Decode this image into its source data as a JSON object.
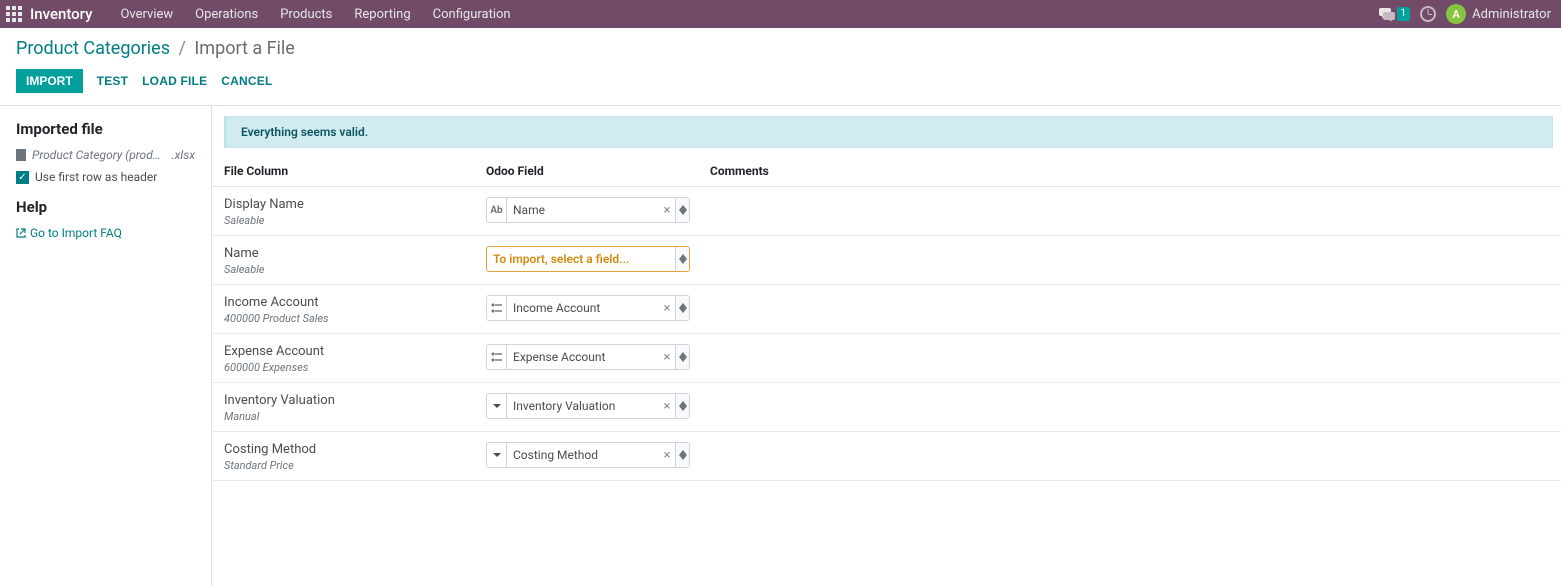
{
  "topbar": {
    "app_name": "Inventory",
    "nav": [
      "Overview",
      "Operations",
      "Products",
      "Reporting",
      "Configuration"
    ],
    "badge_count": "1",
    "avatar_letter": "A",
    "username": "Administrator"
  },
  "breadcrumb": {
    "parent": "Product Categories",
    "current": "Import a File"
  },
  "actions": {
    "import": "IMPORT",
    "test": "TEST",
    "load": "LOAD FILE",
    "cancel": "CANCEL"
  },
  "sidebar": {
    "imported_heading": "Imported file",
    "file_name": "Product Category (product.c…",
    "file_ext": ".xlsx",
    "first_row_label": "Use first row as header",
    "help_heading": "Help",
    "faq_label": "Go to Import FAQ"
  },
  "main": {
    "alert": "Everything seems valid.",
    "headers": {
      "file_col": "File Column",
      "odoo_field": "Odoo Field",
      "comments": "Comments"
    },
    "rows": [
      {
        "column": "Display Name",
        "sample": "Saleable",
        "field_type": "text",
        "field_value": "Name",
        "has_clear": true
      },
      {
        "column": "Name",
        "sample": "Saleable",
        "field_type": "none",
        "field_value": "To import, select a field...",
        "has_clear": false
      },
      {
        "column": "Income Account",
        "sample": "400000 Product Sales",
        "field_type": "m2o",
        "field_value": "Income Account",
        "has_clear": true
      },
      {
        "column": "Expense Account",
        "sample": "600000 Expenses",
        "field_type": "m2o",
        "field_value": "Expense Account",
        "has_clear": true
      },
      {
        "column": "Inventory Valuation",
        "sample": "Manual",
        "field_type": "select",
        "field_value": "Inventory Valuation",
        "has_clear": true
      },
      {
        "column": "Costing Method",
        "sample": "Standard Price",
        "field_type": "select",
        "field_value": "Costing Method",
        "has_clear": true
      }
    ]
  }
}
